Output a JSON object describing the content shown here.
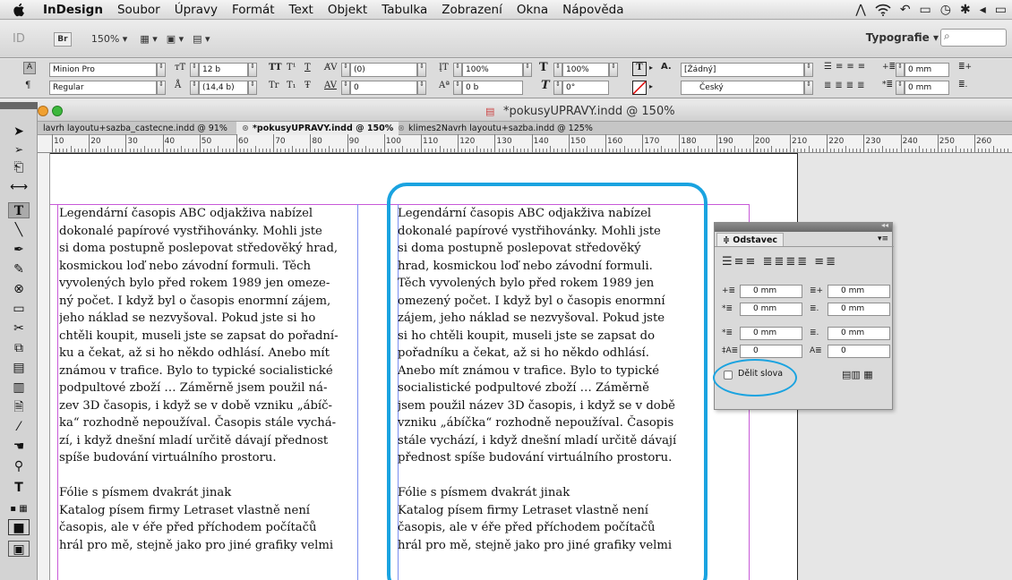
{
  "menubar": {
    "app_name": "InDesign",
    "items": [
      "Soubor",
      "Úpravy",
      "Formát",
      "Text",
      "Objekt",
      "Tabulka",
      "Zobrazení",
      "Okna",
      "Nápověda"
    ]
  },
  "app_bar": {
    "id_logo": "ID",
    "bridge": "Br",
    "zoom": "150% ▾",
    "workspace": "Typografie ▾"
  },
  "control": {
    "font_family": "Minion Pro",
    "font_style": "Regular",
    "font_size": "12 b",
    "leading": "(14,4 b)",
    "tracking_kern": "(0)",
    "tracking": "0",
    "vscale": "100%",
    "hscale": "100%",
    "baseline": "0 b",
    "skew": "0°",
    "char_style": "[Žádný]",
    "language": "Český",
    "indent_left": "0 mm",
    "indent_first": "0 mm",
    "btn_tt": "TT",
    "btn_ts": "T¹",
    "btn_t": "T",
    "btn_tr": "Tr",
    "btn_t1": "T₁",
    "btn_f": "Ŧ",
    "label_a": "A."
  },
  "window": {
    "title": "*pokusyUPRAVY.indd @ 150%",
    "tabs": [
      "lavrh layoutu+sazba_castecne.indd @ 91%",
      "*pokusyUPRAVY.indd @ 150%",
      "klimes2Navrh layoutu+sazba.indd @ 125%"
    ],
    "tab_close": "⊗"
  },
  "ruler": {
    "labels": [
      "10",
      "20",
      "30",
      "40",
      "50",
      "60",
      "70",
      "80",
      "90",
      "100",
      "110",
      "120",
      "130",
      "140",
      "150",
      "160",
      "170",
      "180",
      "190",
      "200",
      "210",
      "220",
      "230",
      "240",
      "250",
      "260"
    ]
  },
  "column_left": {
    "lines": [
      "Legendární časopis ABC odjakživa nabízel",
      "dokonalé papírové vystřihovánky. Mohli jste",
      "si doma postupně poslepovat středověký hrad,",
      "kosmickou loď nebo závodní formuli. Těch",
      "vyvolených bylo před rokem 1989 jen omeze-",
      "ný počet. I když byl o časopis enormní zájem,",
      "jeho náklad se nezvyšoval. Pokud jste si ho",
      "chtěli koupit, museli jste se zapsat do pořadní-",
      "ku a čekat, až si ho někdo odhlásí. Anebo mít",
      "známou v trafice. Bylo to typické socialistické",
      "podpultové zboží … Záměrně jsem použil ná-",
      "zev 3D časopis, i když se v době vzniku „ábíč-",
      "ka“ rozhodně nepoužíval. Časopis stále vychá-",
      "zí, i když dnešní mladí určitě dávají přednost",
      "spíše budování virtuálního prostoru.",
      "",
      "Fólie s písmem dvakrát jinak",
      "Katalog písem firmy Letraset vlastně není",
      "časopis, ale v éře před příchodem počítačů",
      "hrál pro mě, stejně jako pro jiné grafiky velmi"
    ]
  },
  "column_right": {
    "lines": [
      "Legendární časopis ABC odjakživa nabízel",
      "dokonalé papírové vystřihovánky. Mohli jste",
      "si doma postupně poslepovat středověký",
      "hrad, kosmickou loď nebo závodní formuli.",
      "Těch vyvolených bylo před rokem 1989 jen",
      "omezený počet. I když byl o časopis enormní",
      "zájem, jeho náklad se nezvyšoval. Pokud jste",
      "si ho chtěli koupit, museli jste se zapsat do",
      "pořadníku a čekat, až si ho někdo odhlásí.",
      "Anebo mít známou v trafice. Bylo to typické",
      "socialistické podpultové zboží … Záměrně",
      "jsem použil název 3D časopis, i když se v době",
      "vzniku „ábíčka“ rozhodně nepoužíval. Časopis",
      "stále vychází, i když dnešní mladí určitě dávají",
      "přednost spíše budování virtuálního prostoru.",
      "",
      "Fólie s písmem dvakrát jinak",
      "Katalog písem firmy Letraset vlastně není",
      "časopis, ale v éře před příchodem počítačů",
      "hrál pro mě, stejně jako pro jiné grafiky velmi"
    ]
  },
  "panel": {
    "tab_label": "≑ Odstavec",
    "left_indent": "0 mm",
    "right_indent": "0 mm",
    "first_line_indent": "0 mm",
    "last_line_indent": "0 mm",
    "space_before": "0 mm",
    "space_after": "0 mm",
    "drop_cap_lines": "0",
    "drop_cap_chars": "0",
    "hyphenate_label": "Dělit slova"
  },
  "colors": {
    "highlight": "#1aa3e0",
    "margin_guide": "#c85ad8",
    "column_guide": "#7a8ef0"
  },
  "icons": [
    "apple-icon",
    "wifi-icon",
    "bluetooth-icon",
    "volume-icon",
    "battery-icon",
    "search-icon",
    "selection-tool-icon",
    "type-tool-icon",
    "hand-tool-icon",
    "zoom-tool-icon",
    "scissors-tool-icon",
    "pen-tool-icon"
  ]
}
